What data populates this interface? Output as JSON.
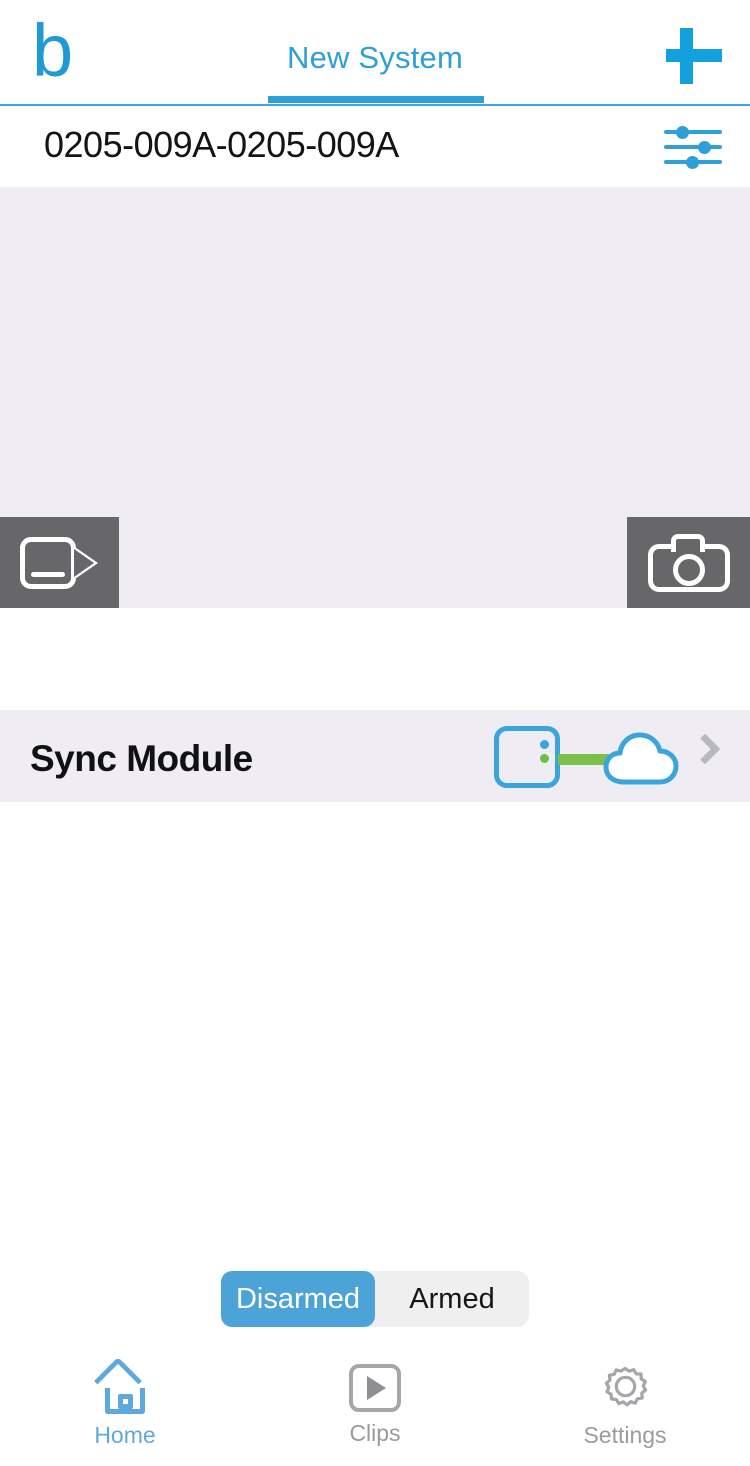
{
  "app": {
    "logo": "b",
    "logo_icon": "blink-logo-b"
  },
  "header": {
    "tab_label": "New System",
    "add_icon": "plus-icon",
    "add_label": "+"
  },
  "camera_row": {
    "name": "0205-009A-0205-009A",
    "settings_icon": "sliders-icon"
  },
  "thumbnail": {
    "state": "empty",
    "record_icon": "video-camera-icon",
    "snapshot_icon": "photo-camera-icon"
  },
  "sync_module": {
    "label": "Sync Module",
    "module_icon": "sync-module-icon",
    "cloud_icon": "cloud-icon",
    "link_status_color": "#7cc04b",
    "status_dot_blue": "#3aa5dd",
    "status_dot_green": "#6cbe45",
    "chevron_icon": "chevron-right-icon"
  },
  "arm_control": {
    "options": [
      {
        "label": "Disarmed",
        "selected": true
      },
      {
        "label": "Armed",
        "selected": false
      }
    ]
  },
  "tabbar": {
    "items": [
      {
        "label": "Home",
        "icon": "home-icon",
        "active": true
      },
      {
        "label": "Clips",
        "icon": "play-box-icon",
        "active": false
      },
      {
        "label": "Settings",
        "icon": "gear-icon",
        "active": false
      }
    ]
  },
  "colors": {
    "accent": "#2e9fd8",
    "accent_light": "#4ba3d8",
    "panel_bg": "#efedf3",
    "button_gray": "#67676a",
    "inactive_text": "#9a9a9f"
  }
}
